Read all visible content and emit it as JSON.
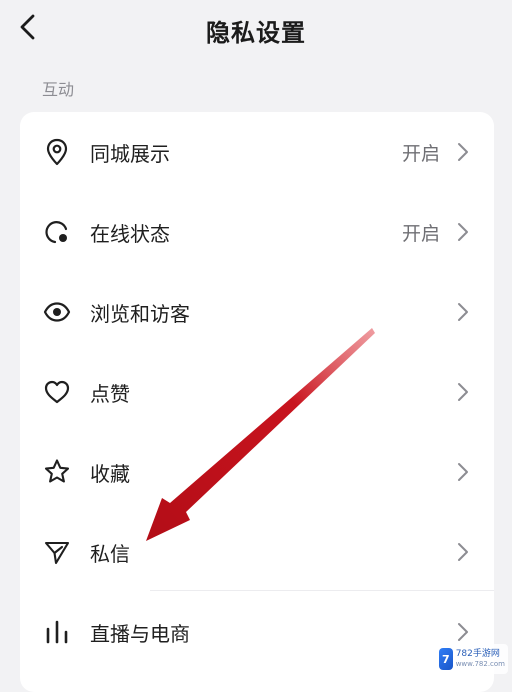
{
  "header": {
    "title": "隐私设置"
  },
  "section": {
    "label": "互动"
  },
  "rows": [
    {
      "label": "同城展示",
      "value": "开启",
      "icon": "location-pin-icon"
    },
    {
      "label": "在线状态",
      "value": "开启",
      "icon": "online-status-icon"
    },
    {
      "label": "浏览和访客",
      "value": "",
      "icon": "eye-icon"
    },
    {
      "label": "点赞",
      "value": "",
      "icon": "heart-icon"
    },
    {
      "label": "收藏",
      "value": "",
      "icon": "star-icon"
    },
    {
      "label": "私信",
      "value": "",
      "icon": "send-icon"
    },
    {
      "label": "直播与电商",
      "value": "",
      "icon": "bar-chart-icon"
    }
  ],
  "colors": {
    "annotation_arrow": "#c8141e",
    "background": "#f2f2f4",
    "card": "#ffffff"
  },
  "watermark": {
    "site": "782手游网",
    "url": "www.782.com"
  }
}
